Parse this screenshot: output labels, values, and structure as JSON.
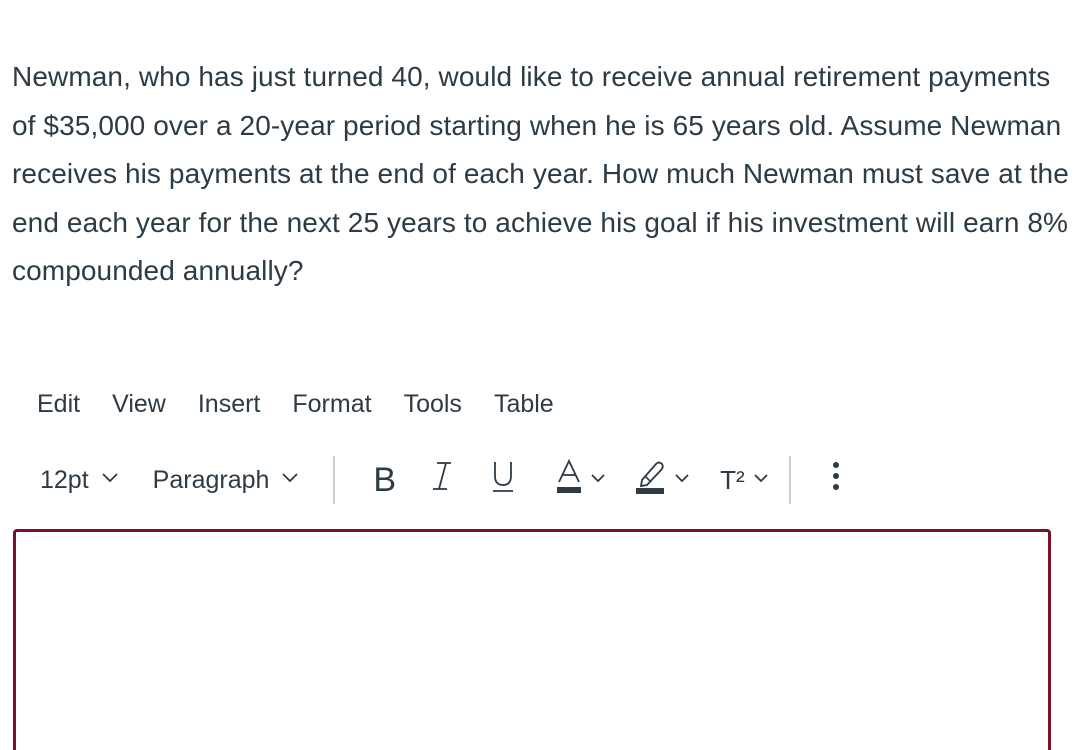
{
  "question": {
    "text": "Newman, who has just turned 40, would like to receive annual retirement payments of $35,000 over a 20-year period starting when he is 65 years old. Assume Newman receives his payments at the end of each year. How much Newman must save at the end each year for the next 25 years to achieve his goal if his investment will earn 8% compounded annually?"
  },
  "menubar": {
    "edit": "Edit",
    "view": "View",
    "insert": "Insert",
    "format": "Format",
    "tools": "Tools",
    "table": "Table"
  },
  "toolbar": {
    "font_size": "12pt",
    "block_format": "Paragraph",
    "bold": "B",
    "italic": "I",
    "underline": "U",
    "text_color": "A",
    "superscript": "T²",
    "more": "⋮"
  },
  "editor": {
    "content": ""
  },
  "colors": {
    "text": "#2d3b45",
    "editor_border": "#7a0f25",
    "divider": "#c7cdd1"
  },
  "icons": {
    "highlight": "highlighter-icon",
    "chevron": "chevron-down-icon",
    "more": "more-vertical-icon"
  }
}
